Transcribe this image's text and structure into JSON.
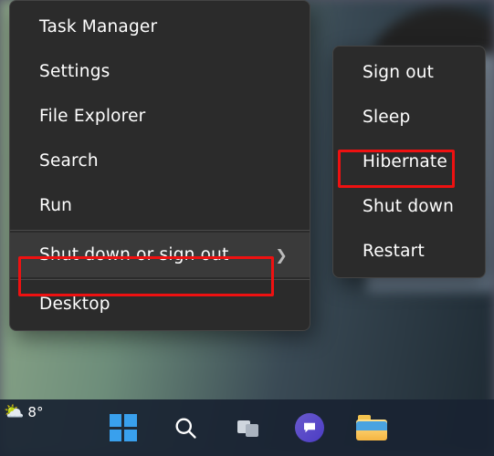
{
  "main_menu": {
    "items": [
      {
        "label": "Task Manager"
      },
      {
        "label": "Settings"
      },
      {
        "label": "File Explorer"
      },
      {
        "label": "Search"
      },
      {
        "label": "Run"
      },
      {
        "label": "Shut down or sign out",
        "has_submenu": true,
        "hover": true
      },
      {
        "label": "Desktop"
      }
    ]
  },
  "sub_menu": {
    "items": [
      {
        "label": "Sign out"
      },
      {
        "label": "Sleep"
      },
      {
        "label": "Hibernate"
      },
      {
        "label": "Shut down"
      },
      {
        "label": "Restart"
      }
    ]
  },
  "taskbar": {
    "weather_temp": "8°",
    "icons": {
      "start": "start-icon",
      "search": "search-icon",
      "taskview": "task-view-icon",
      "chat": "chat-icon",
      "explorer": "file-explorer-icon"
    }
  },
  "highlights": {
    "main": "Shut down or sign out",
    "sub": "Hibernate"
  }
}
